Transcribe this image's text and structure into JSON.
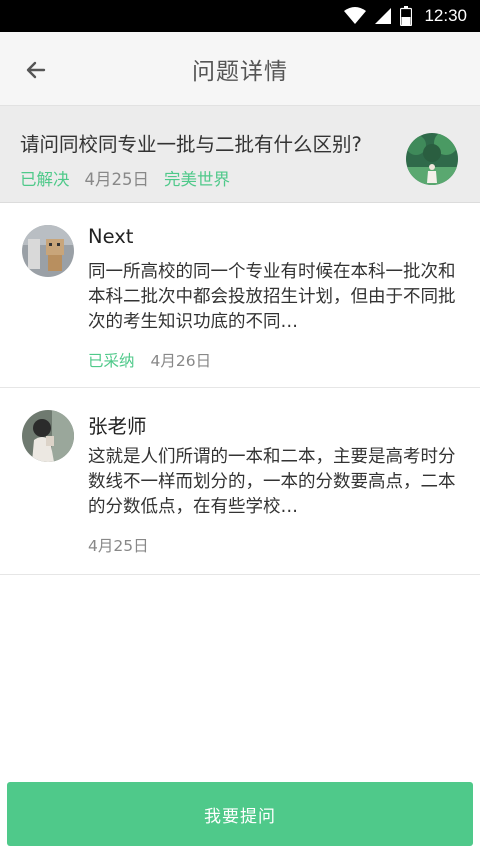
{
  "status_bar": {
    "time": "12:30",
    "icons": [
      "wifi-icon",
      "signal-icon",
      "battery-icon"
    ]
  },
  "app_bar": {
    "title": "问题详情",
    "back_icon": "arrow-left-icon"
  },
  "question": {
    "title": "请问同校同专业一批与二批有什么区别?",
    "status": "已解决",
    "date": "4月25日",
    "author": "完美世界"
  },
  "answers": [
    {
      "name": "Next",
      "body": "同一所高校的同一个专业有时候在本科一批次和本科二批次中都会投放招生计划，但由于不同批次的考生知识功底的不同…",
      "status": "已采纳",
      "date": "4月26日"
    },
    {
      "name": "张老师",
      "body": "这就是人们所谓的一本和二本，主要是高考时分数线不一样而划分的，一本的分数要高点，二本的分数低点，在有些学校…",
      "date": "4月25日"
    }
  ],
  "ask_button": {
    "label": "我要提问"
  },
  "colors": {
    "accent": "#4fc98a",
    "header_bg": "#ececec",
    "status_bar": "#000000"
  }
}
